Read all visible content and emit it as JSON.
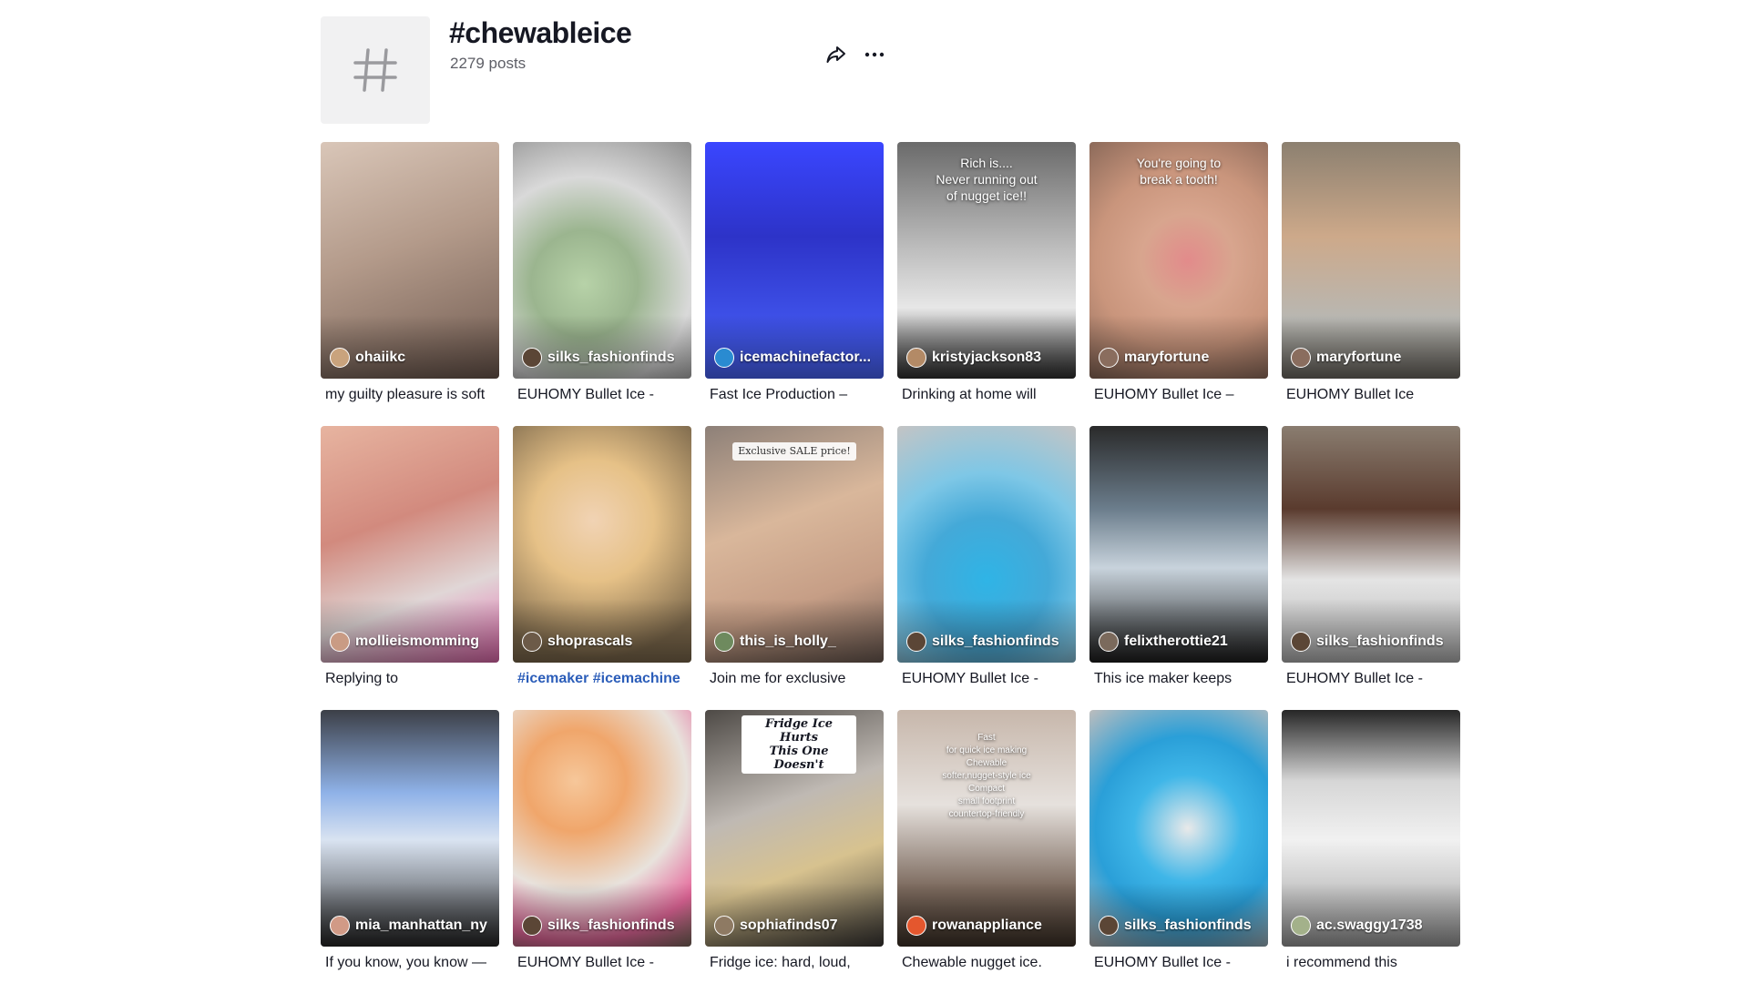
{
  "header": {
    "tag_icon": "hashtag-icon",
    "title": "#chewableice",
    "post_count": "2279 posts",
    "share_icon": "share-icon",
    "more_icon": "more-horizontal-icon"
  },
  "posts": [
    {
      "author": "ohaiikc",
      "caption": "my guilty pleasure is soft",
      "overlay": "",
      "bg": "linear-gradient(160deg,#d9c6b8 0%,#b39a8a 45%,#6f5a50 100%)",
      "avatar": "#c9a37d"
    },
    {
      "author": "silks_fashionfinds",
      "caption": "EUHOMY Bullet Ice -",
      "overlay": "",
      "bg": "radial-gradient(circle at 40% 60%,#b7d2a8 0%,#9bb58f 30%,#d9d9d9 60%,#8e8e8e 100%)",
      "avatar": "#5b4636"
    },
    {
      "author": "icemachinefactor...",
      "caption": "Fast Ice Production –",
      "overlay": "",
      "bg": "linear-gradient(180deg,#3a46ff 0%,#2d33c8 40%,#4a66ff 100%)",
      "avatar": "#2a8bd1"
    },
    {
      "author": "kristyjackson83",
      "caption": "Drinking at home will",
      "overlay": "Rich is....\nNever running out\nof nugget ice!!",
      "bg": "linear-gradient(180deg,#6a6a6a 0%,#bdbdbd 45%,#e7e7e7 70%,#2f2f2f 100%)",
      "avatar": "#b38a66"
    },
    {
      "author": "maryfortune",
      "caption": "EUHOMY Bullet Ice –",
      "overlay": "You're going to\nbreak a tooth!",
      "bg": "radial-gradient(circle at 55% 50%,#e28b8b 0%,#d8a58e 30%,#c9957c 60%,#8c6a5a 100%)",
      "avatar": "#8a6d5e"
    },
    {
      "author": "maryfortune",
      "caption": "EUHOMY Bullet Ice",
      "overlay": "",
      "bg": "linear-gradient(180deg,#8c8070 0%,#cda98a 40%,#b8b7b2 75%,#6e6a63 100%)",
      "avatar": "#8a6d5e"
    },
    {
      "author": "mollieismomming",
      "caption": "Replying to",
      "overlay": "",
      "bg": "linear-gradient(160deg,#e7b4a0 0%,#d28a7e 40%,#e0d6d6 70%,#e86cb2 100%)",
      "avatar": "#c99b84"
    },
    {
      "author": "shoprascals",
      "caption": "#icemaker #icemachine",
      "overlay": "",
      "bg": "radial-gradient(circle at 45% 40%,#f1d3b4 0%,#e6c187 35%,#7e6a4d 80%)",
      "avatar": "#6c5a48"
    },
    {
      "author": "this_is_holly_",
      "caption": "Join me for exclusive",
      "overlay": "Exclusive SALE price!",
      "bg": "linear-gradient(160deg,#8d8078 0%,#d9b79b 40%,#c69e86 70%,#6f5d54 100%)",
      "avatar": "#6e8a5e"
    },
    {
      "author": "silks_fashionfinds",
      "caption": "EUHOMY Bullet Ice -",
      "overlay": "",
      "bg": "radial-gradient(circle at 50% 65%,#2fb4e6 0%,#44a9d8 35%,#7ec7e6 60%,#c4c4c4 100%)",
      "avatar": "#5b4636"
    },
    {
      "author": "felixtherottie21",
      "caption": "This ice maker keeps",
      "overlay": "",
      "bg": "linear-gradient(180deg,#2a2a2a 0%,#6b7d8c 35%,#c8d3dc 60%,#1e1e1e 100%)",
      "avatar": "#7b6a5c"
    },
    {
      "author": "silks_fashionfinds",
      "caption": "EUHOMY Bullet Ice -",
      "overlay": "",
      "bg": "linear-gradient(180deg,#8a7d70 0%,#5a3b2e 35%,#e4e4e4 65%,#b4b4b4 100%)",
      "avatar": "#5b4636"
    },
    {
      "author": "mia_manhattan_ny",
      "caption": "If you know, you know —",
      "overlay": "",
      "bg": "linear-gradient(180deg,#3c3f47 0%,#8fb2e8 35%,#d9e3f1 55%,#262626 100%)",
      "avatar": "#d19a86"
    },
    {
      "author": "silks_fashionfinds",
      "caption": "EUHOMY Bullet Ice -",
      "overlay": "",
      "bg": "radial-gradient(circle at 35% 30%,#f6c79a 0%,#f0a66b 25%,#e8e2dc 55%,#e5689b 80%,#7c6a5c 100%)",
      "avatar": "#5b4636"
    },
    {
      "author": "sophiafinds07",
      "caption": "Fridge ice: hard, loud,",
      "overlay": "Fridge Ice Hurts\nThis One Doesn't",
      "bg": "linear-gradient(160deg,#4e4a46 0%,#bfb9b3 40%,#d7c28f 65%,#3b3835 100%)",
      "avatar": "#8e7a63"
    },
    {
      "author": "rowanappliance",
      "caption": "Chewable nugget ice.",
      "overlay": "Fast\nfor quick ice making\nChewable\nsofter,nugget-style ice\nCompact\nsmall footprint\ncountertop-friendly",
      "bg": "linear-gradient(180deg,#c7b7ab 0%,#e6e1dd 40%,#7d6b5f 75%,#3f3329 100%)",
      "avatar": "#e4572e"
    },
    {
      "author": "silks_fashionfinds",
      "caption": "EUHOMY Bullet Ice -",
      "overlay": "",
      "bg": "radial-gradient(circle at 55% 50%,#e9e9e9 0%,#3fb6e8 35%,#2a9fd8 60%,#bdbdbd 100%)",
      "avatar": "#5b4636"
    },
    {
      "author": "ac.swaggy1738",
      "caption": "i recommend this",
      "overlay": "",
      "bg": "linear-gradient(180deg,#262626 0%,#d6d6d6 30%,#f1f1f1 55%,#9a9a9a 100%)",
      "avatar": "#a3b18a"
    }
  ]
}
